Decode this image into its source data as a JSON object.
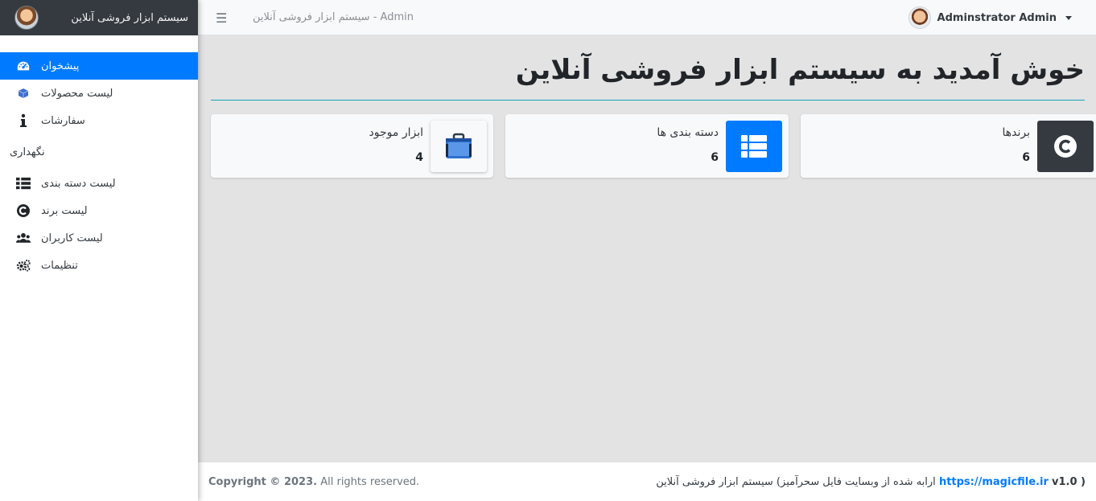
{
  "brand": {
    "title": "سیستم ابزار فروشی آنلاین"
  },
  "sidebar": {
    "items": [
      {
        "label": "پیشخوان",
        "icon": "dashboard-icon",
        "active": true
      },
      {
        "label": "لیست محصولات",
        "icon": "cube-icon"
      },
      {
        "label": "سفارشات",
        "icon": "info-icon"
      }
    ],
    "section_header": "نگهداری",
    "maintenance_items": [
      {
        "label": "لیست دسته بندی",
        "icon": "list-icon"
      },
      {
        "label": "لیست برند",
        "icon": "copyright-icon"
      },
      {
        "label": "لیست کاربران",
        "icon": "users-icon"
      },
      {
        "label": "تنظیمات",
        "icon": "gears-icon"
      }
    ]
  },
  "topbar": {
    "title": "سیستم ابزار فروشی آنلاین - Admin",
    "user_name": "Adminstrator Admin"
  },
  "main": {
    "heading": "خوش آمدید به سیستم ابزار فروشی آنلاین",
    "cards": [
      {
        "label": "برندها",
        "value": "6",
        "icon": "copyright-icon",
        "color": "#343a40"
      },
      {
        "label": "دسته بندی ها",
        "value": "6",
        "icon": "th-list-icon",
        "color": "#007bff"
      },
      {
        "label": "ابزار موجود",
        "value": "4",
        "icon": "toolbox-icon",
        "color": "#f8f9fa"
      }
    ]
  },
  "footer": {
    "copyright_bold": "Copyright © 2023.",
    "copyright_rest": "All rights reserved.",
    "powered_text": "سیستم ابزار فروشی آنلاین (ارابه شده از وبسایت فایل سحرآمیز",
    "link": "https://magicfile.ir",
    "version": "v1.0 )"
  },
  "colors": {
    "accent": "#007bff",
    "dark": "#343a40",
    "rule": "#17a2b8"
  }
}
